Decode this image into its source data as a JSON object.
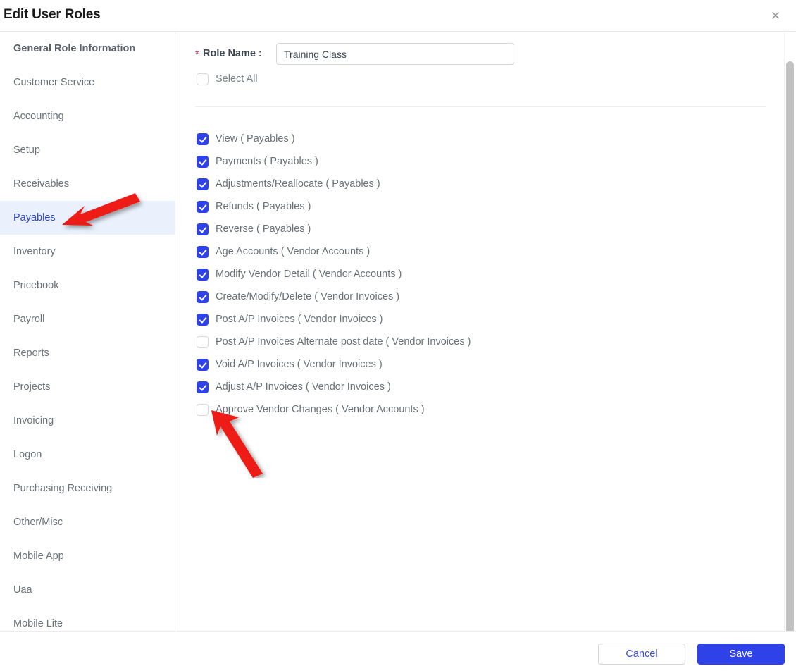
{
  "dialog": {
    "title": "Edit User Roles",
    "close_icon": "close-icon",
    "close_glyph": "✕"
  },
  "sidebar": {
    "items": [
      {
        "label": "General Role Information",
        "active": false,
        "bold": true
      },
      {
        "label": "Customer Service",
        "active": false,
        "bold": false
      },
      {
        "label": "Accounting",
        "active": false,
        "bold": false
      },
      {
        "label": "Setup",
        "active": false,
        "bold": false
      },
      {
        "label": "Receivables",
        "active": false,
        "bold": false
      },
      {
        "label": "Payables",
        "active": true,
        "bold": false
      },
      {
        "label": "Inventory",
        "active": false,
        "bold": false
      },
      {
        "label": "Pricebook",
        "active": false,
        "bold": false
      },
      {
        "label": "Payroll",
        "active": false,
        "bold": false
      },
      {
        "label": "Reports",
        "active": false,
        "bold": false
      },
      {
        "label": "Projects",
        "active": false,
        "bold": false
      },
      {
        "label": "Invoicing",
        "active": false,
        "bold": false
      },
      {
        "label": "Logon",
        "active": false,
        "bold": false
      },
      {
        "label": "Purchasing Receiving",
        "active": false,
        "bold": false
      },
      {
        "label": "Other/Misc",
        "active": false,
        "bold": false
      },
      {
        "label": "Mobile App",
        "active": false,
        "bold": false
      },
      {
        "label": "Uaa",
        "active": false,
        "bold": false
      },
      {
        "label": "Mobile Lite",
        "active": false,
        "bold": false
      }
    ]
  },
  "form": {
    "required_marker": "*",
    "role_name_label": "Role Name :",
    "role_name_value": "Training Class",
    "role_name_placeholder": "",
    "select_all_label": "Select All",
    "select_all_checked": false
  },
  "permissions": [
    {
      "label": "View ( Payables )",
      "checked": true
    },
    {
      "label": "Payments ( Payables )",
      "checked": true
    },
    {
      "label": "Adjustments/Reallocate ( Payables )",
      "checked": true
    },
    {
      "label": "Refunds ( Payables )",
      "checked": true
    },
    {
      "label": "Reverse ( Payables )",
      "checked": true
    },
    {
      "label": "Age Accounts ( Vendor Accounts )",
      "checked": true
    },
    {
      "label": "Modify Vendor Detail ( Vendor Accounts )",
      "checked": true
    },
    {
      "label": "Create/Modify/Delete ( Vendor Invoices )",
      "checked": true
    },
    {
      "label": "Post A/P Invoices ( Vendor Invoices )",
      "checked": true
    },
    {
      "label": "Post A/P Invoices Alternate post date ( Vendor Invoices )",
      "checked": false
    },
    {
      "label": "Void A/P Invoices ( Vendor Invoices )",
      "checked": true
    },
    {
      "label": "Adjust A/P Invoices ( Vendor Invoices )",
      "checked": true
    },
    {
      "label": "Approve Vendor Changes ( Vendor Accounts )",
      "checked": false
    }
  ],
  "footer": {
    "cancel_label": "Cancel",
    "save_label": "Save"
  },
  "annotations": [
    {
      "name": "arrow-pointing-to-payables",
      "color": "#ee1c13"
    },
    {
      "name": "arrow-pointing-to-approve-vendor-changes",
      "color": "#ee1c13"
    }
  ],
  "colors": {
    "accent": "#2f42e8",
    "active_row_bg": "#eaf1fd",
    "active_row_text": "#2b43d8",
    "required_star": "#d6264a",
    "label_text": "#6b7178",
    "annotation_red": "#ee1c13"
  }
}
